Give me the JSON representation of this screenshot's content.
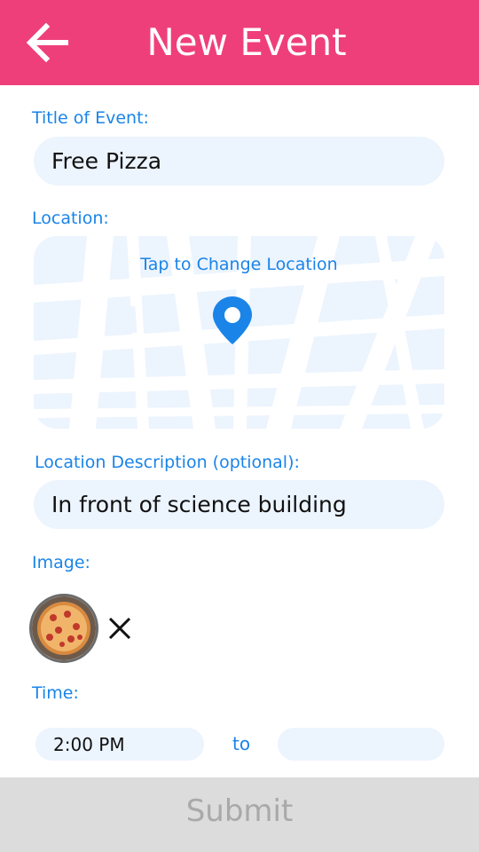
{
  "header": {
    "title": "New Event",
    "back_icon": "back-arrow-icon"
  },
  "form": {
    "title_label": "Title of Event:",
    "title_value": "Free Pizza",
    "location_label": "Location:",
    "map_hint": "Tap to Change Location",
    "location_desc_label": "Location Description (optional):",
    "location_desc_value": "In front of science building",
    "image_label": "Image:",
    "remove_icon": "close-icon",
    "time_label": "Time:",
    "time_start": "2:00 PM",
    "time_separator": "to",
    "time_end": ""
  },
  "footer": {
    "submit_label": "Submit"
  },
  "colors": {
    "accent": "#ef3f7a",
    "label_blue": "#1a84e8",
    "field_bg": "#ecf4fe",
    "submit_disabled_bg": "#dcdcdc"
  }
}
